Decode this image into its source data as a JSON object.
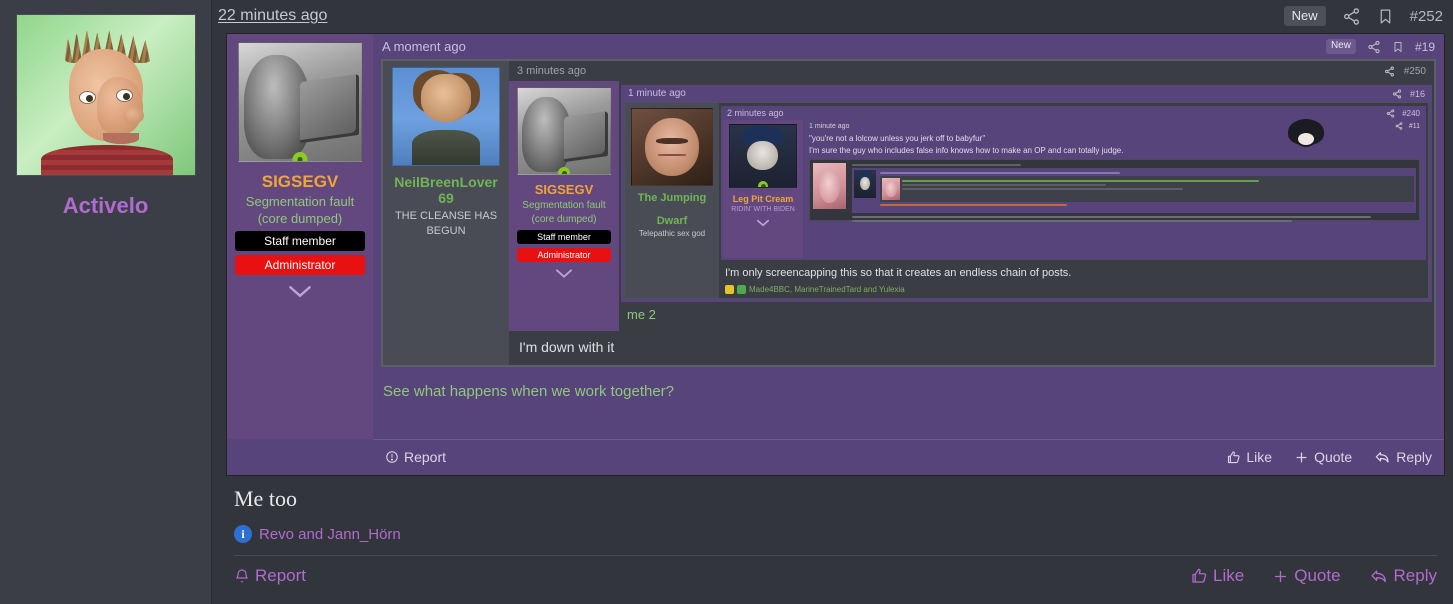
{
  "sidebar": {
    "username": "Activelo",
    "avatar_name": "activelo-avatar"
  },
  "main_post": {
    "time": "22 minutes ago",
    "new_badge": "New",
    "post_id": "#252",
    "share_icon": "share-icon",
    "bookmark_icon": "bookmark-icon"
  },
  "level1": {
    "user": {
      "name": "SIGSEGV",
      "title_line1": "Segmentation fault",
      "title_line2": "(core dumped)",
      "badge_staff": "Staff member",
      "badge_admin": "Administrator"
    },
    "message": "See what happens when we work together?",
    "footer": {
      "report": "Report",
      "like": "Like",
      "quote": "Quote",
      "reply": "Reply"
    }
  },
  "level2": {
    "time": "A moment ago",
    "new_badge": "New",
    "post_id": "#19",
    "user": {
      "name_line1": "NeilBreenLover",
      "name_line2": "69",
      "title_line1": "THE CLEANSE HAS",
      "title_line2": "BEGUN"
    },
    "message": "I'm down with it"
  },
  "level3": {
    "time": "3 minutes ago",
    "post_id": "#250",
    "user": {
      "name": "SIGSEGV",
      "title_line1": "Segmentation fault",
      "title_line2": "(core dumped)",
      "badge_staff": "Staff member",
      "badge_admin": "Administrator"
    },
    "message": "me 2"
  },
  "level4": {
    "time": "1 minute ago",
    "post_id": "#16",
    "user": {
      "name_line1": "The Jumping",
      "name_line2": "Dwarf",
      "title": "Telepathic sex god"
    },
    "message": "I'm only screencapping this so that it creates an endless chain of posts.",
    "reaction_names": "Made4BBC, MarineTrainedTard and Yulexia"
  },
  "level5": {
    "time": "2 minutes ago",
    "post_id": "#240",
    "user": {
      "name_line1": "Leg Pit Cream",
      "title": "RIDIN' WITH BIDEN"
    }
  },
  "level6": {
    "time": "1 minute ago",
    "post_id": "#11",
    "quote_line": "\"you're not a lolcow unless you jerk off to babyfur\"",
    "reply_line": "I'm sure the guy who includes false info knows how to make an OP and can totally judge."
  },
  "bottom_post": {
    "title": "Me too",
    "reaction_names": "Revo and Jann_Hörn",
    "report": "Report",
    "like": "Like",
    "quote": "Quote",
    "reply": "Reply"
  },
  "colors": {
    "page_bg": "#32353b",
    "purple_post": "#57447a",
    "purple_user": "#63487f",
    "dark_post": "#3a3d44",
    "accent_pink": "#b06bcf",
    "name_orange": "#f0a537",
    "name_green": "#72b455",
    "admin_red": "#e81010",
    "online_green": "#8bc926"
  }
}
